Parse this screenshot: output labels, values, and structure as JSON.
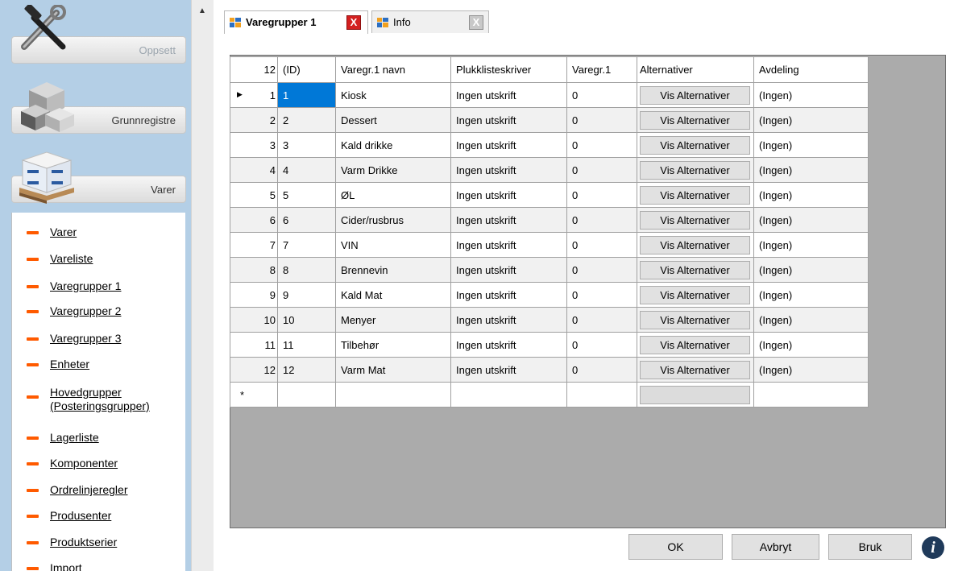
{
  "sidebar": {
    "categories": [
      {
        "label": "Oppsett",
        "icon": "tools-icon"
      },
      {
        "label": "Grunnregistre",
        "icon": "cubes-icon"
      },
      {
        "label": "Varer",
        "icon": "pallet-boxes-icon"
      }
    ],
    "links": [
      "Varer",
      "Vareliste",
      "Varegrupper 1",
      "Varegrupper 2",
      "Varegrupper 3",
      "Enheter",
      "Hovedgrupper\n(Posteringsgrupper)",
      "Lagerliste",
      "Komponenter",
      "Ordrelinjeregler",
      "Produsenter",
      "Produktserier",
      "Import"
    ],
    "link_color": "#ff5a00"
  },
  "tabs": [
    {
      "label": "Varegrupper 1",
      "active": true,
      "close": "X"
    },
    {
      "label": "Info",
      "active": false,
      "close": "X"
    }
  ],
  "grid": {
    "columns": [
      "12",
      "(ID)",
      "Varegr.1 navn",
      "Plukklisteskriver",
      "Varegr.1",
      "Alternativer",
      "Avdeling"
    ],
    "rows": [
      {
        "n": "1",
        "id": "1",
        "name": "Kiosk",
        "printer": "Ingen utskrift",
        "vg": "0",
        "alt": "Vis Alternativer",
        "avd": "(Ingen)"
      },
      {
        "n": "2",
        "id": "2",
        "name": "Dessert",
        "printer": "Ingen utskrift",
        "vg": "0",
        "alt": "Vis Alternativer",
        "avd": "(Ingen)"
      },
      {
        "n": "3",
        "id": "3",
        "name": "Kald drikke",
        "printer": "Ingen utskrift",
        "vg": "0",
        "alt": "Vis Alternativer",
        "avd": "(Ingen)"
      },
      {
        "n": "4",
        "id": "4",
        "name": "Varm Drikke",
        "printer": "Ingen utskrift",
        "vg": "0",
        "alt": "Vis Alternativer",
        "avd": "(Ingen)"
      },
      {
        "n": "5",
        "id": "5",
        "name": "ØL",
        "printer": "Ingen utskrift",
        "vg": "0",
        "alt": "Vis Alternativer",
        "avd": "(Ingen)"
      },
      {
        "n": "6",
        "id": "6",
        "name": "Cider/rusbrus",
        "printer": "Ingen utskrift",
        "vg": "0",
        "alt": "Vis Alternativer",
        "avd": "(Ingen)"
      },
      {
        "n": "7",
        "id": "7",
        "name": "VIN",
        "printer": "Ingen utskrift",
        "vg": "0",
        "alt": "Vis Alternativer",
        "avd": "(Ingen)"
      },
      {
        "n": "8",
        "id": "8",
        "name": "Brennevin",
        "printer": "Ingen utskrift",
        "vg": "0",
        "alt": "Vis Alternativer",
        "avd": "(Ingen)"
      },
      {
        "n": "9",
        "id": "9",
        "name": "Kald Mat",
        "printer": "Ingen utskrift",
        "vg": "0",
        "alt": "Vis Alternativer",
        "avd": "(Ingen)"
      },
      {
        "n": "10",
        "id": "10",
        "name": "Menyer",
        "printer": "Ingen utskrift",
        "vg": "0",
        "alt": "Vis Alternativer",
        "avd": "(Ingen)"
      },
      {
        "n": "11",
        "id": "11",
        "name": "Tilbehør",
        "printer": "Ingen utskrift",
        "vg": "0",
        "alt": "Vis Alternativer",
        "avd": "(Ingen)"
      },
      {
        "n": "12",
        "id": "12",
        "name": "Varm Mat",
        "printer": "Ingen utskrift",
        "vg": "0",
        "alt": "Vis Alternativer",
        "avd": "(Ingen)"
      }
    ],
    "new_row_marker": "*",
    "current_row_marker": "▶",
    "selection_color": "#0078d7"
  },
  "buttons": {
    "ok": "OK",
    "cancel": "Avbryt",
    "apply": "Bruk",
    "info": "i"
  }
}
